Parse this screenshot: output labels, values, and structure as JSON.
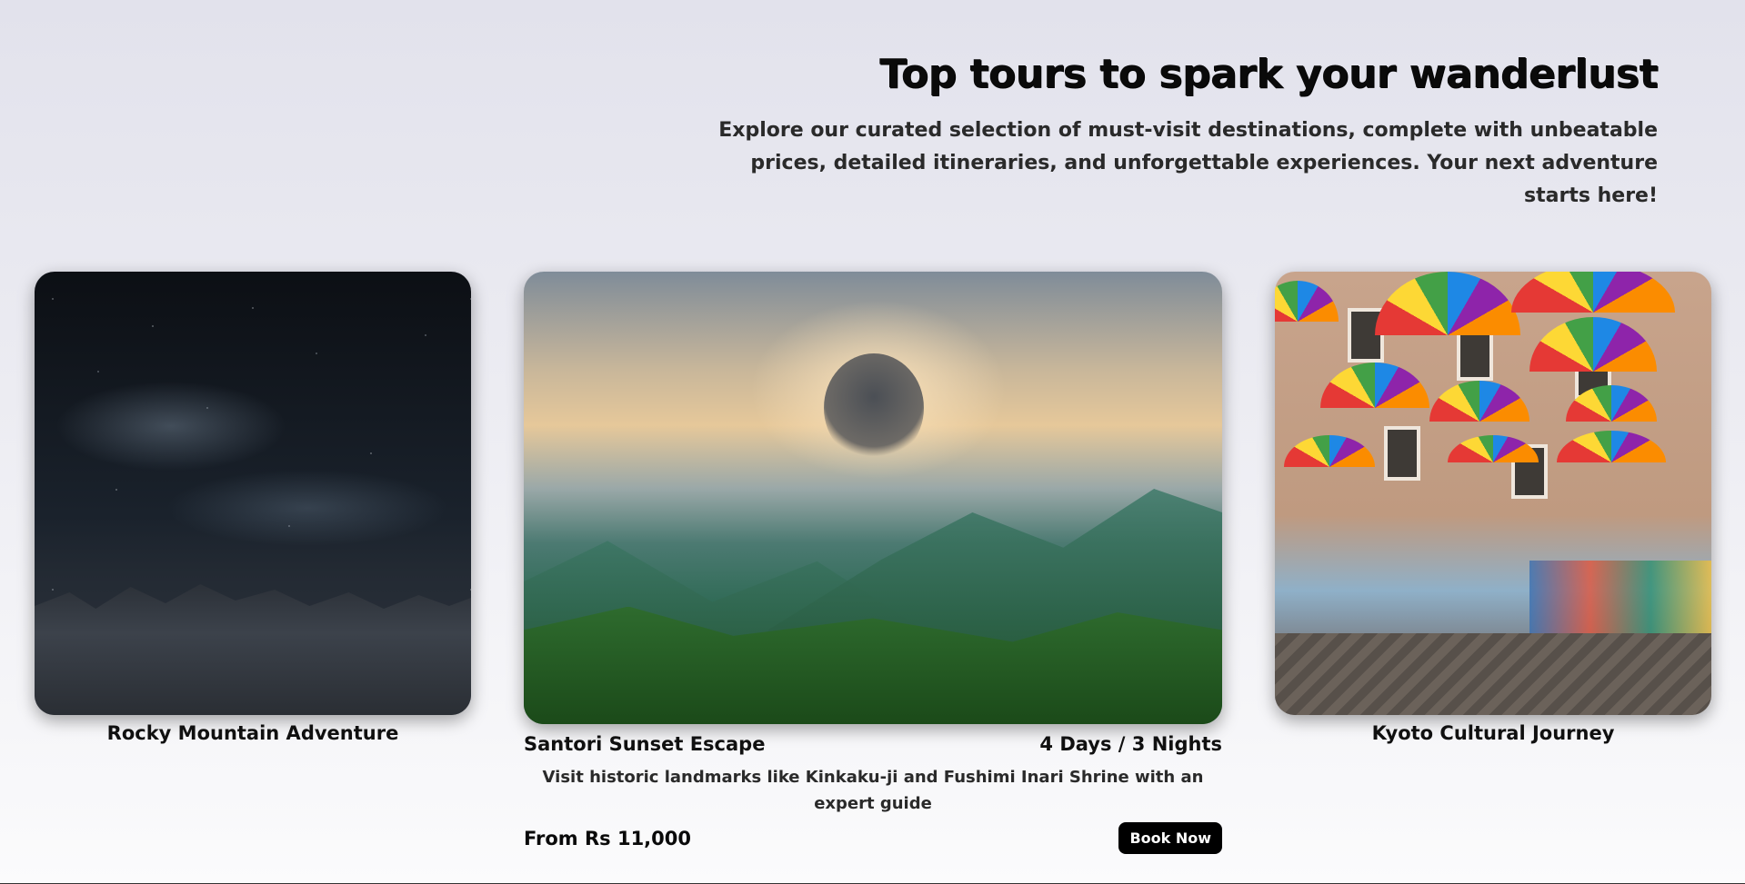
{
  "hero": {
    "title": "Top tours to spark your wanderlust",
    "subtitle": "Explore our curated selection of must-visit destinations, complete with unbeatable prices, detailed itineraries, and unforgettable experiences. Your next adventure starts here!"
  },
  "tours": [
    {
      "name": "Rocky Mountain Adventure"
    },
    {
      "name": "Santori Sunset Escape",
      "duration": "4 Days / 3 Nights",
      "description": "Visit historic landmarks like Kinkaku-ji and Fushimi Inari Shrine with an expert guide",
      "price": "From Rs 11,000",
      "cta": "Book Now"
    },
    {
      "name": "Kyoto Cultural Journey"
    }
  ],
  "colors": {
    "button_bg": "#000000",
    "button_text": "#ffffff"
  }
}
